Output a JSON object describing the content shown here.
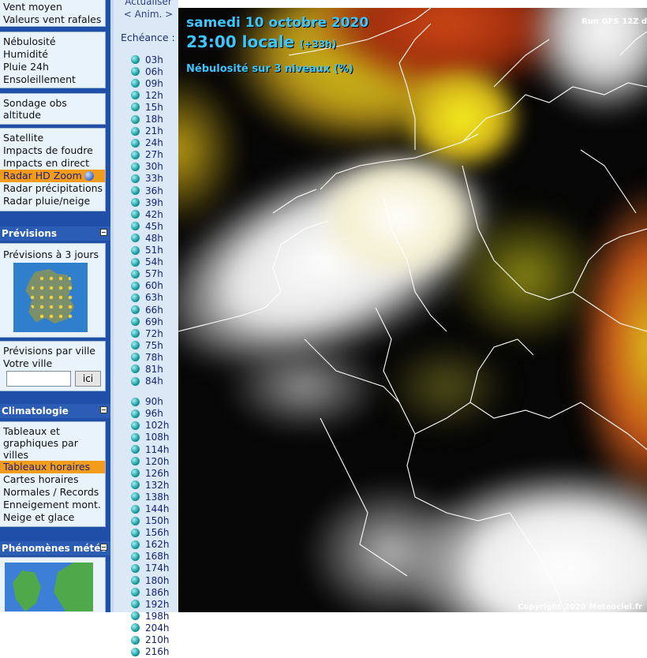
{
  "sidebar": {
    "wind_items": [
      "Vent moyen",
      "Valeurs vent rafales"
    ],
    "cloud_items": [
      "Nébulosité",
      "Humidité",
      "Pluie 24h",
      "Ensoleillement"
    ],
    "sounding_item": "Sondage obs altitude",
    "obs_items": [
      "Satellite",
      "Impacts de foudre",
      "Impacts en direct",
      "Radar HD Zoom",
      "Radar précipitations",
      "Radar pluie/neige"
    ],
    "forecast_header": "Prévisions",
    "forecast_3days": "Prévisions à 3 jours",
    "forecast_city": "Prévisions par ville",
    "votre_ville": "Votre ville",
    "search_value": "",
    "ici_label": "ici",
    "clim_header": "Climatologie",
    "clim_items": [
      "Tableaux et graphiques par villes",
      "Tableaux horaires",
      "Cartes horaires",
      "Normales / Records",
      "Enneigement mont.",
      "Neige et glace"
    ],
    "phen_header": "Phénomènes météo"
  },
  "echeance": {
    "actualiser": "Actualiser",
    "anim": "< Anim. >",
    "label": "Echéance :",
    "steps_a": [
      "03h",
      "06h",
      "09h",
      "12h",
      "15h",
      "18h",
      "21h",
      "24h",
      "27h",
      "30h",
      "33h",
      "36h",
      "39h",
      "42h",
      "45h",
      "48h",
      "51h",
      "54h",
      "57h",
      "60h",
      "63h",
      "66h",
      "69h",
      "72h",
      "75h",
      "78h",
      "81h",
      "84h"
    ],
    "steps_b": [
      "90h",
      "96h",
      "102h",
      "108h",
      "114h",
      "120h",
      "126h",
      "132h",
      "138h",
      "144h",
      "150h",
      "156h",
      "162h",
      "168h",
      "174h",
      "180h",
      "186h",
      "192h",
      "198h",
      "204h",
      "210h",
      "216h"
    ]
  },
  "map": {
    "date_day": "samedi",
    "date_rest": "10 octobre 2020",
    "time": "23:00 locale",
    "offset": "(+33h)",
    "parameter": "Nébulosité sur 3 niveaux (%)",
    "run": "Run GFS 12Z d",
    "copyright": "Copyright 2020 Meteociel.fr"
  },
  "colors": {
    "highlight": "#f39b1b",
    "sidebar_bg": "#1f4fa6",
    "title_cyan": "#3cc6ff"
  }
}
